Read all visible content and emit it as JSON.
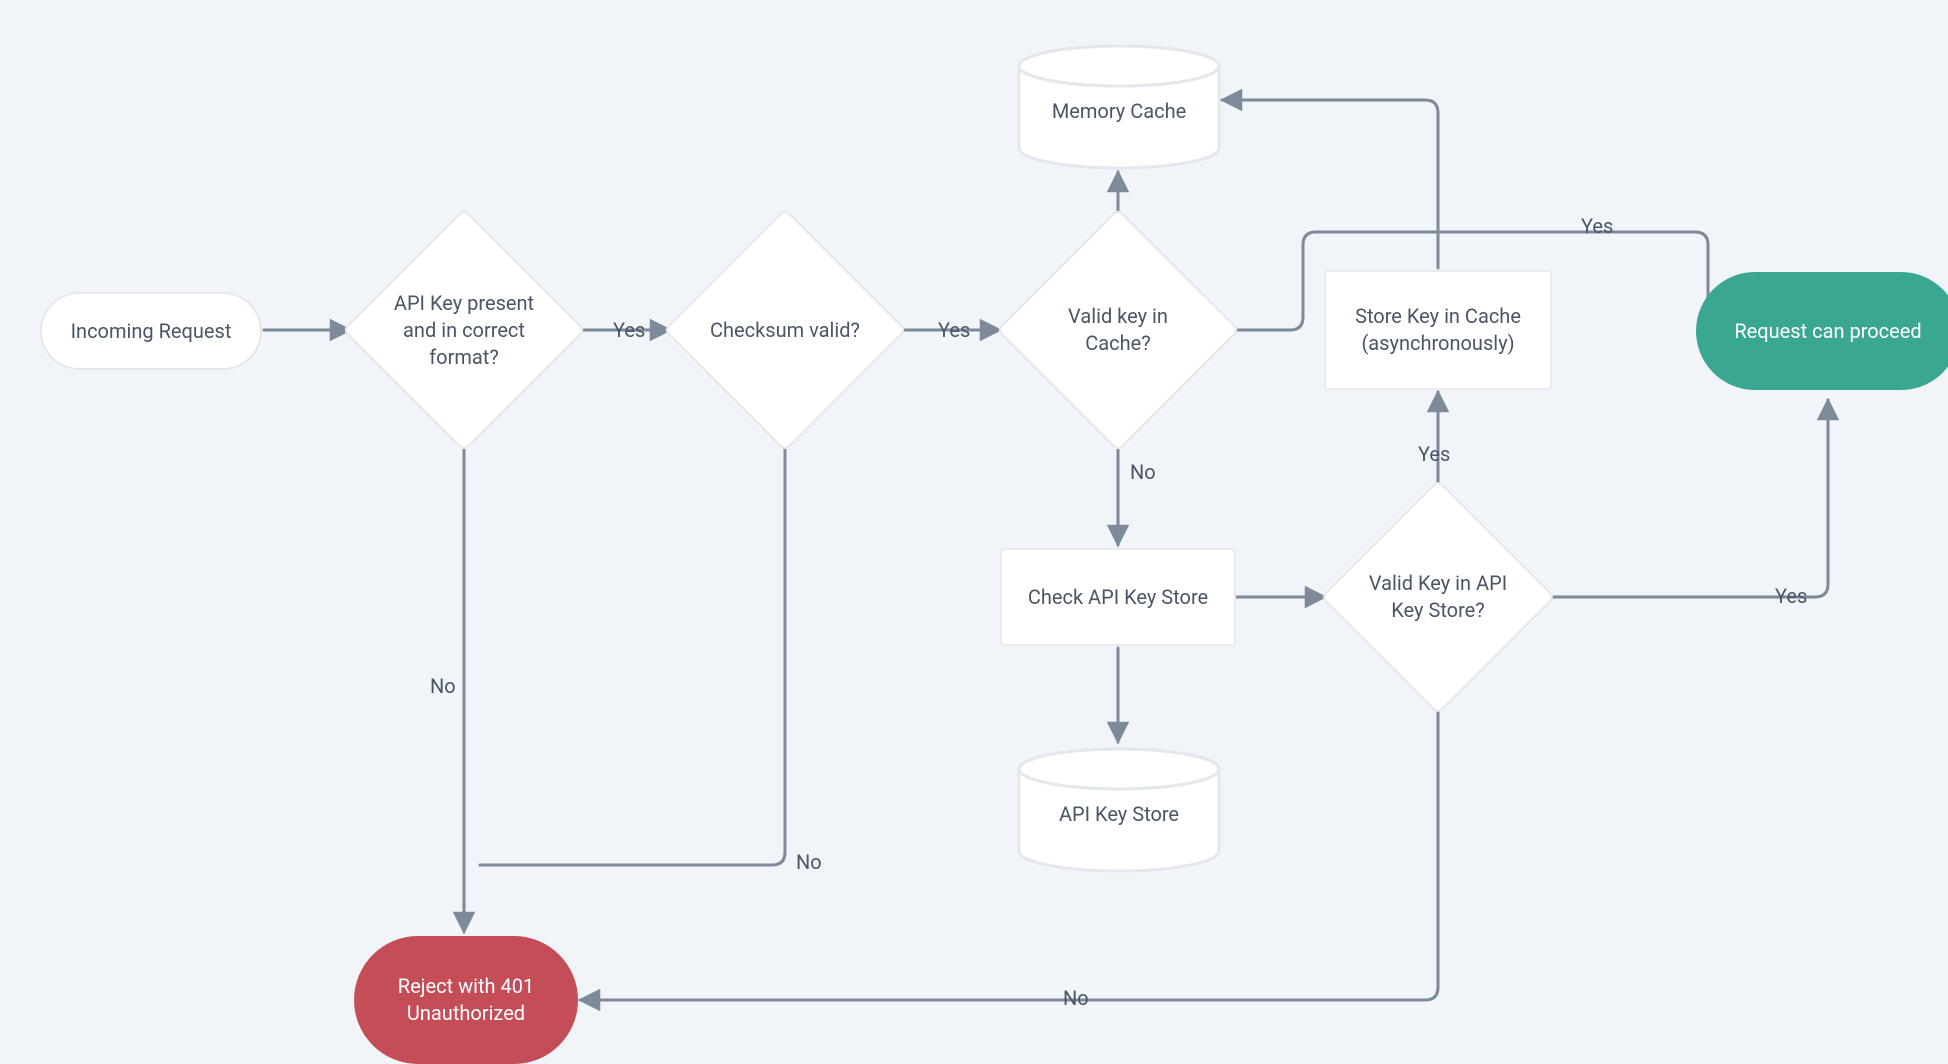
{
  "colors": {
    "bg": "#f1f4f8",
    "node_fill": "#ffffff",
    "node_border": "#e4e8ee",
    "text": "#4a5665",
    "edge": "#7c8a9a",
    "reject_fill": "#c44d58",
    "proceed_fill": "#3aa793"
  },
  "nodes": {
    "incoming": {
      "type": "terminator",
      "label": "Incoming Request"
    },
    "key_present": {
      "type": "decision",
      "label": "API Key present and in correct format?"
    },
    "checksum": {
      "type": "decision",
      "label": "Checksum valid?"
    },
    "cache_valid": {
      "type": "decision",
      "label": "Valid key in Cache?"
    },
    "mem_cache": {
      "type": "datastore",
      "label": "Memory Cache"
    },
    "store_cache": {
      "type": "process",
      "label": "Store Key in Cache (asynchronously)"
    },
    "proceed": {
      "type": "terminator",
      "label": "Request can proceed"
    },
    "check_store": {
      "type": "process",
      "label": "Check API Key Store"
    },
    "key_store": {
      "type": "datastore",
      "label": "API Key Store"
    },
    "store_valid": {
      "type": "decision",
      "label": "Valid Key in API Key Store?"
    },
    "reject": {
      "type": "terminator",
      "label": "Reject with 401 Unauthorized"
    }
  },
  "edges": [
    {
      "from": "incoming",
      "to": "key_present",
      "label": ""
    },
    {
      "from": "key_present",
      "to": "checksum",
      "label": "Yes"
    },
    {
      "from": "checksum",
      "to": "cache_valid",
      "label": "Yes"
    },
    {
      "from": "cache_valid",
      "to": "mem_cache",
      "label": ""
    },
    {
      "from": "cache_valid",
      "to": "proceed",
      "label": "Yes",
      "via": "store_cache_top"
    },
    {
      "from": "cache_valid",
      "to": "check_store",
      "label": "No"
    },
    {
      "from": "check_store",
      "to": "key_store",
      "label": ""
    },
    {
      "from": "check_store",
      "to": "store_valid",
      "label": ""
    },
    {
      "from": "store_valid",
      "to": "store_cache",
      "label": "Yes"
    },
    {
      "from": "store_valid",
      "to": "proceed",
      "label": "Yes"
    },
    {
      "from": "store_cache",
      "to": "mem_cache",
      "label": ""
    },
    {
      "from": "key_present",
      "to": "reject",
      "label": "No"
    },
    {
      "from": "checksum",
      "to": "reject",
      "label": "No"
    },
    {
      "from": "store_valid",
      "to": "reject",
      "label": "No"
    }
  ],
  "edge_labels": {
    "yes": "Yes",
    "no": "No"
  }
}
